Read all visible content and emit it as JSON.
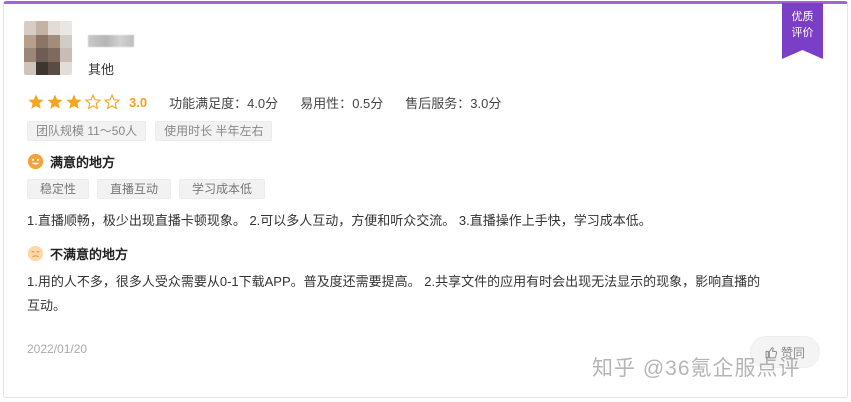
{
  "badge": {
    "line1": "优质",
    "line2": "评价"
  },
  "reviewer": {
    "role": "其他"
  },
  "rating": {
    "stars_filled": 3,
    "stars_total": 5,
    "score": "3.0",
    "metrics": [
      {
        "label": "功能满足度：",
        "value": "4.0分"
      },
      {
        "label": "易用性：",
        "value": "0.5分"
      },
      {
        "label": "售后服务：",
        "value": "3.0分"
      }
    ]
  },
  "info_tags": [
    "团队规模 11～50人",
    "使用时长 半年左右"
  ],
  "pros": {
    "heading": "满意的地方",
    "tags": [
      "稳定性",
      "直播互动",
      "学习成本低"
    ],
    "text": "1.直播顺畅，极少出现直播卡顿现象。 2.可以多人互动，方便和听众交流。 3.直播操作上手快，学习成本低。"
  },
  "cons": {
    "heading": "不满意的地方",
    "text_line1": "1.用的人不多，很多人受众需要从0-1下载APP。普及度还需要提高。 2.共享文件的应用有时会出现无法显示的现象，影响直播的",
    "text_line2": "互动。"
  },
  "date": "2022/01/20",
  "like_label": "赞同",
  "watermark": "知乎 @36氪企服点评",
  "colors": {
    "accent": "#a265d8",
    "badge": "#7a3fc6",
    "star": "#f5a623",
    "score": "#f0a020"
  }
}
